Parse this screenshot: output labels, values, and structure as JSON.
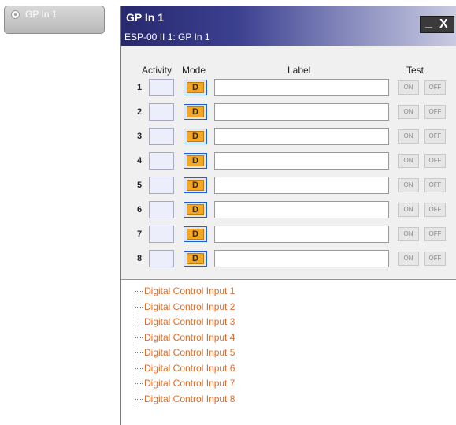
{
  "block": {
    "label": "GP In 1"
  },
  "window": {
    "title": "GP In 1",
    "subtitle": "ESP-00 II 1: GP In 1",
    "minimize_glyph": "_",
    "close_glyph": "X"
  },
  "headers": {
    "activity": "Activity",
    "mode": "Mode",
    "label": "Label",
    "test": "Test"
  },
  "rows": [
    {
      "num": "1",
      "mode": "D",
      "label": "",
      "on": "ON",
      "off": "OFF"
    },
    {
      "num": "2",
      "mode": "D",
      "label": "",
      "on": "ON",
      "off": "OFF"
    },
    {
      "num": "3",
      "mode": "D",
      "label": "",
      "on": "ON",
      "off": "OFF"
    },
    {
      "num": "4",
      "mode": "D",
      "label": "",
      "on": "ON",
      "off": "OFF"
    },
    {
      "num": "5",
      "mode": "D",
      "label": "",
      "on": "ON",
      "off": "OFF"
    },
    {
      "num": "6",
      "mode": "D",
      "label": "",
      "on": "ON",
      "off": "OFF"
    },
    {
      "num": "7",
      "mode": "D",
      "label": "",
      "on": "ON",
      "off": "OFF"
    },
    {
      "num": "8",
      "mode": "D",
      "label": "",
      "on": "ON",
      "off": "OFF"
    }
  ],
  "tree": [
    "Digital Control Input 1",
    "Digital Control Input 2",
    "Digital Control Input 3",
    "Digital Control Input 4",
    "Digital Control Input 5",
    "Digital Control Input 6",
    "Digital Control Input 7",
    "Digital Control Input 8"
  ],
  "colors": {
    "mode_button": "#f5a623",
    "tree_text": "#e06a26",
    "title_bar": "#27286e"
  }
}
